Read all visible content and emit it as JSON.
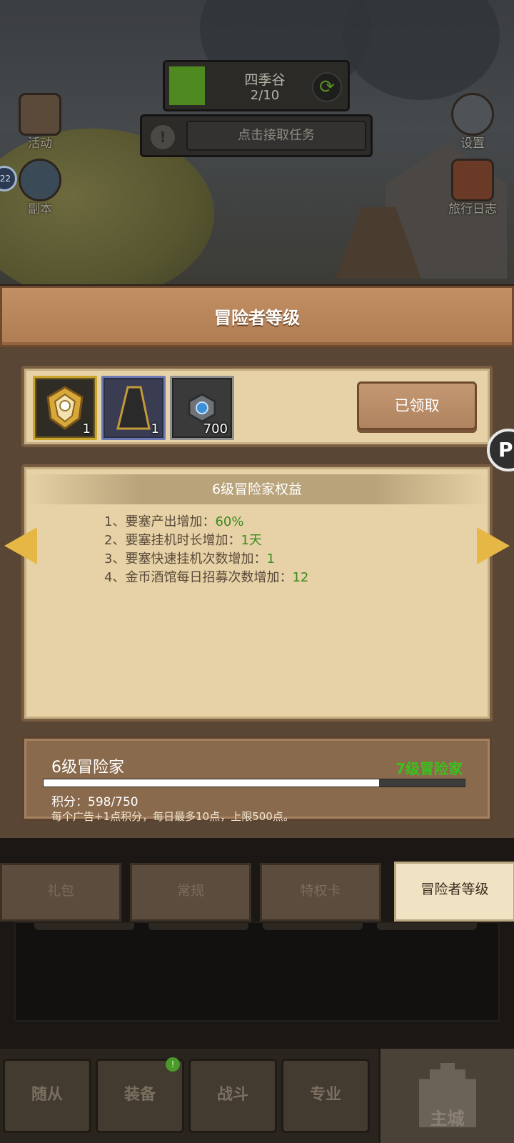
{
  "hud": {
    "stage_name": "四季谷",
    "stage_progress": "2/10",
    "task_text": "点击接取任务"
  },
  "side_left": [
    {
      "label": "活动",
      "icon": "event-icon"
    },
    {
      "label": "副本",
      "icon": "dungeon-icon"
    }
  ],
  "side_right": [
    {
      "label": "设置",
      "icon": "gear-icon"
    },
    {
      "label": "旅行日志",
      "icon": "journal-icon"
    }
  ],
  "side_badge": "22",
  "panel": {
    "title": "冒险者等级",
    "rewards": [
      {
        "name": "helmet-icon",
        "qty": "1",
        "rarity_color": "#c8a52a"
      },
      {
        "name": "cape-icon",
        "qty": "1",
        "rarity_color": "#6c78b4"
      },
      {
        "name": "gem-icon",
        "qty": "700",
        "rarity_color": "#8f8f8f"
      }
    ],
    "claim_label": "已领取",
    "benefit_title": "6级冒险家权益",
    "benefits": [
      {
        "label": "1、要塞产出增加：",
        "value": "60%"
      },
      {
        "label": "2、要塞挂机时长增加：",
        "value": "1天"
      },
      {
        "label": "3、要塞快速挂机次数增加：",
        "value": "1"
      },
      {
        "label": "4、金币酒馆每日招募次数增加：",
        "value": "12"
      }
    ],
    "current_level": "6级冒险家",
    "next_level": "7级冒险家",
    "score_label": "积分：",
    "score_text": "598/750",
    "score_current": 598,
    "score_max": 750,
    "note": "每个广告+1点积分，每日最多10点，上限500点。"
  },
  "round_badge": "P",
  "tabs": [
    {
      "label": "礼包",
      "active": false
    },
    {
      "label": "常规",
      "active": false
    },
    {
      "label": "特权卡",
      "active": false
    },
    {
      "label": "冒险者等级",
      "active": true
    }
  ],
  "bottom_nav": [
    {
      "label": "随从"
    },
    {
      "label": "装备"
    },
    {
      "label": "战斗"
    },
    {
      "label": "专业"
    }
  ],
  "main_city_label": "主城",
  "equip_dot": "!",
  "colors": {
    "accent_green": "#39c21a",
    "value_green": "#3c8a1e",
    "arrow_gold": "#e7b746"
  }
}
